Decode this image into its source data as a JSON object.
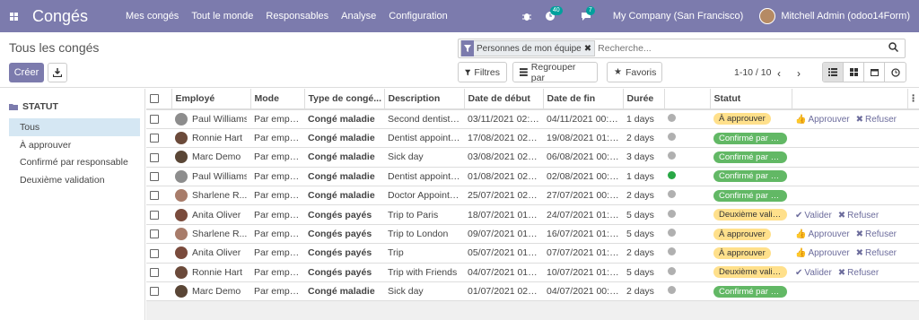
{
  "app": {
    "title": "Congés"
  },
  "menu": [
    "Mes congés",
    "Tout le monde",
    "Responsables",
    "Analyse",
    "Configuration"
  ],
  "systray": {
    "activity_count": "40",
    "messages_count": "7",
    "company": "My Company (San Francisco)",
    "user": "Mitchell Admin (odoo14Form)"
  },
  "breadcrumb": "Tous les congés",
  "buttons": {
    "create": "Créer",
    "filters": "Filtres",
    "group_by": "Regrouper par",
    "favorites": "Favoris"
  },
  "search": {
    "facet": "Personnes de mon équipe",
    "placeholder": "Recherche..."
  },
  "pager": "1-10 / 10",
  "sidebar": {
    "heading": "STATUT",
    "items": [
      "Tous",
      "À approuver",
      "Confirmé par responsable",
      "Deuxième validation"
    ]
  },
  "table": {
    "headers": [
      "Employé",
      "Mode",
      "Type de congé...",
      "Description",
      "Date de début",
      "Date de fin",
      "Durée",
      "",
      "Statut",
      ""
    ],
    "rows": [
      {
        "employee": "Paul Williams",
        "mode": "Par emplo...",
        "type": "Congé maladie",
        "desc": "Second dentist a...",
        "start": "03/11/2021 02:0...",
        "end": "04/11/2021 00:0...",
        "duration": "1 days",
        "dot": "#b0b0b0",
        "status": "À approuver",
        "status_color": "yellow",
        "actions": [
          "Approuver",
          "Refuser"
        ]
      },
      {
        "employee": "Ronnie Hart",
        "mode": "Par emplo...",
        "type": "Congé maladie",
        "desc": "Dentist appointm...",
        "start": "17/08/2021 02:0...",
        "end": "19/08/2021 01:0...",
        "duration": "2 days",
        "dot": "#b0b0b0",
        "status": "Confirmé par re...",
        "status_color": "green",
        "actions": []
      },
      {
        "employee": "Marc Demo",
        "mode": "Par emplo...",
        "type": "Congé maladie",
        "desc": "Sick day",
        "start": "03/08/2021 02:0...",
        "end": "06/08/2021 00:0...",
        "duration": "3 days",
        "dot": "#b0b0b0",
        "status": "Confirmé par re...",
        "status_color": "green",
        "actions": []
      },
      {
        "employee": "Paul Williams",
        "mode": "Par emplo...",
        "type": "Congé maladie",
        "desc": "Dentist appointm...",
        "start": "01/08/2021 02:0...",
        "end": "02/08/2021 00:0...",
        "duration": "1 days",
        "dot": "#28a745",
        "status": "Confirmé par re...",
        "status_color": "green",
        "actions": []
      },
      {
        "employee": "Sharlene R...",
        "mode": "Par emplo...",
        "type": "Congé maladie",
        "desc": "Doctor Appointm...",
        "start": "25/07/2021 02:0...",
        "end": "27/07/2021 00:0...",
        "duration": "2 days",
        "dot": "#b0b0b0",
        "status": "Confirmé par re...",
        "status_color": "green",
        "actions": []
      },
      {
        "employee": "Anita Oliver",
        "mode": "Par emplo...",
        "type": "Congés payés",
        "desc": "Trip to Paris",
        "start": "18/07/2021 01:0...",
        "end": "24/07/2021 01:0...",
        "duration": "5 days",
        "dot": "#b0b0b0",
        "status": "Deuxième valid...",
        "status_color": "yellow",
        "actions": [
          "Valider",
          "Refuser"
        ]
      },
      {
        "employee": "Sharlene R...",
        "mode": "Par emplo...",
        "type": "Congés payés",
        "desc": "Trip to London",
        "start": "09/07/2021 01:0...",
        "end": "16/07/2021 01:0...",
        "duration": "5 days",
        "dot": "#b0b0b0",
        "status": "À approuver",
        "status_color": "yellow",
        "actions": [
          "Approuver",
          "Refuser"
        ]
      },
      {
        "employee": "Anita Oliver",
        "mode": "Par emplo...",
        "type": "Congés payés",
        "desc": "Trip",
        "start": "05/07/2021 01:0...",
        "end": "07/07/2021 01:0...",
        "duration": "2 days",
        "dot": "#b0b0b0",
        "status": "À approuver",
        "status_color": "yellow",
        "actions": [
          "Approuver",
          "Refuser"
        ]
      },
      {
        "employee": "Ronnie Hart",
        "mode": "Par emplo...",
        "type": "Congés payés",
        "desc": "Trip with Friends",
        "start": "04/07/2021 01:0...",
        "end": "10/07/2021 01:0...",
        "duration": "5 days",
        "dot": "#b0b0b0",
        "status": "Deuxième valid...",
        "status_color": "yellow",
        "actions": [
          "Valider",
          "Refuser"
        ]
      },
      {
        "employee": "Marc Demo",
        "mode": "Par emplo...",
        "type": "Congé maladie",
        "desc": "Sick day",
        "start": "01/07/2021 02:0...",
        "end": "04/07/2021 00:0...",
        "duration": "2 days",
        "dot": "#b0b0b0",
        "status": "Confirmé par re...",
        "status_color": "green",
        "actions": []
      }
    ]
  },
  "colors": {
    "brand": "#7c7bad",
    "confirmed": "#62b865",
    "pending": "#ffe08b"
  }
}
